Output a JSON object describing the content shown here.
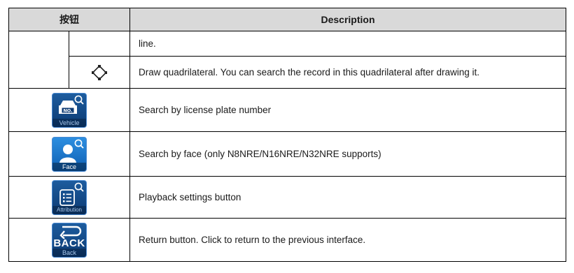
{
  "table": {
    "header": {
      "col_button": "按钮",
      "col_description": "Description"
    },
    "rows": [
      {
        "desc": "line."
      },
      {
        "icon": "quadrilateral-icon",
        "desc": "Draw quadrilateral. You can search the record in this quadrilateral after drawing it."
      },
      {
        "icon": "vehicle-search-icon",
        "caption": "Vehicle",
        "plate_text": "NO.",
        "desc": "Search by license plate number"
      },
      {
        "icon": "face-search-icon",
        "caption": "Face",
        "desc": "Search by face (only N8NRE/N16NRE/N32NRE supports)"
      },
      {
        "icon": "attribution-search-icon",
        "caption": "Attribution",
        "desc": "Playback settings button"
      },
      {
        "icon": "back-icon",
        "caption": "Back",
        "label": "BACK",
        "desc": "Return button. Click to return to the previous interface."
      }
    ]
  },
  "colors": {
    "header_bg": "#d9d9d9",
    "icon_bg": "#0c3a73",
    "face_bg": "#1e7fd6"
  }
}
